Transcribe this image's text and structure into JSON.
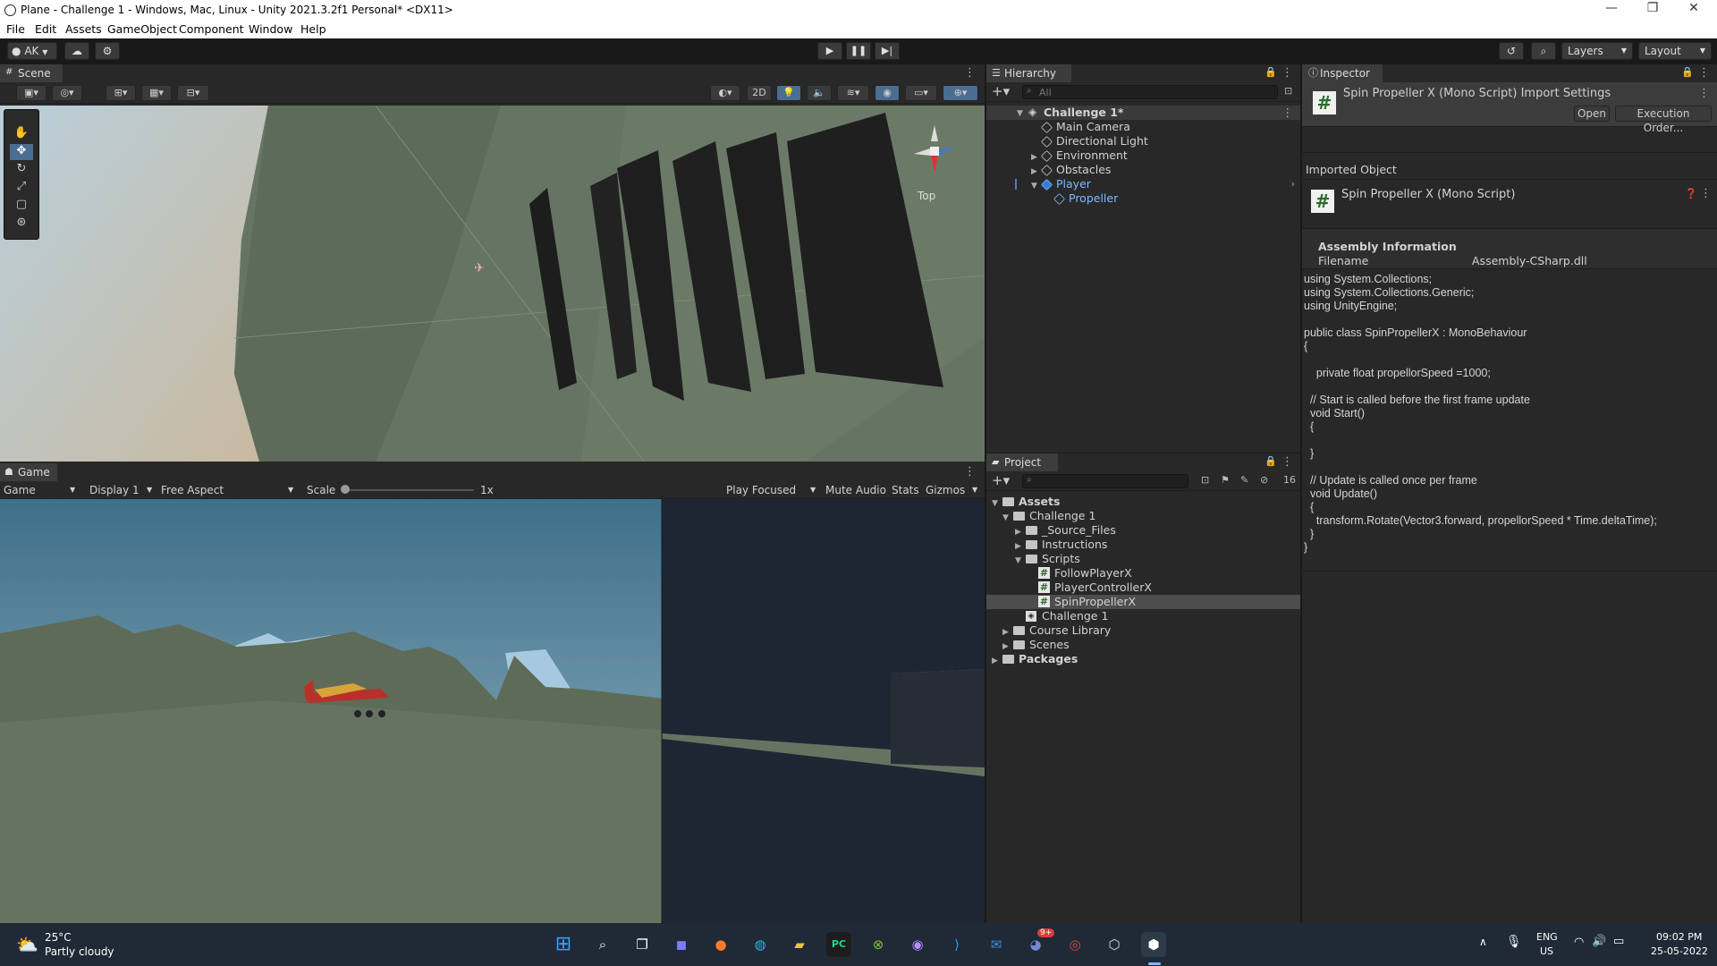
{
  "window": {
    "title": "Plane - Challenge 1 - Windows, Mac, Linux - Unity 2021.3.2f1 Personal* <DX11>"
  },
  "menu": [
    "File",
    "Edit",
    "Assets",
    "GameObject",
    "Component",
    "Window",
    "Help"
  ],
  "toolbar": {
    "account": "AK",
    "layers": "Layers",
    "layout": "Layout"
  },
  "scene": {
    "tab": "Scene",
    "mode2d": "2D",
    "gizmo_label": "Top"
  },
  "game": {
    "tab": "Game",
    "view": "Game",
    "display": "Display 1",
    "aspect": "Free Aspect",
    "scale_label": "Scale",
    "scale_value": "1x",
    "play_mode": "Play Focused",
    "mute": "Mute Audio",
    "stats": "Stats",
    "gizmos": "Gizmos"
  },
  "hierarchy": {
    "tab": "Hierarchy",
    "search_placeholder": "All",
    "scene": "Challenge 1*",
    "items": [
      "Main Camera",
      "Directional Light",
      "Environment",
      "Obstacles",
      "Player"
    ],
    "child": "Propeller"
  },
  "project": {
    "tab": "Project",
    "hidden_count": "16",
    "assets": "Assets",
    "challenge": "Challenge 1",
    "source": "_Source_Files",
    "instructions": "Instructions",
    "scripts": "Scripts",
    "script_files": [
      "FollowPlayerX",
      "PlayerControllerX",
      "SpinPropellerX"
    ],
    "scene_asset": "Challenge 1",
    "course_library": "Course Library",
    "scenes": "Scenes",
    "packages": "Packages"
  },
  "inspector": {
    "tab": "Inspector",
    "header": "Spin Propeller X (Mono Script) Import Settings",
    "open": "Open",
    "execution_order": "Execution Order...",
    "imported_object": "Imported Object",
    "object_name": "Spin Propeller X (Mono Script)",
    "assembly_info": "Assembly Information",
    "filename_label": "Filename",
    "filename_value": "Assembly-CSharp.dll",
    "code": [
      "using System.Collections;",
      "using System.Collections.Generic;",
      "using UnityEngine;",
      "",
      "public class SpinPropellerX : MonoBehaviour",
      "{",
      "",
      "    private float propellorSpeed =1000;",
      "",
      "  // Start is called before the first frame update",
      "  void Start()",
      "  {",
      "",
      "  }",
      "",
      "  // Update is called once per frame",
      "  void Update()",
      "  {",
      "    transform.Rotate(Vector3.forward, propellorSpeed * Time.deltaTime);",
      "  }",
      "}"
    ]
  },
  "taskbar": {
    "weather_temp": "25°C",
    "weather_desc": "Partly cloudy",
    "lang": "ENG",
    "region": "US",
    "time": "09:02 PM",
    "date": "25-05-2022",
    "badge": "9+"
  },
  "colors": {
    "accent": "#4c7fbf",
    "panel": "#282828",
    "selected": "#2c5d87",
    "taskbar": "#1f2a36"
  }
}
